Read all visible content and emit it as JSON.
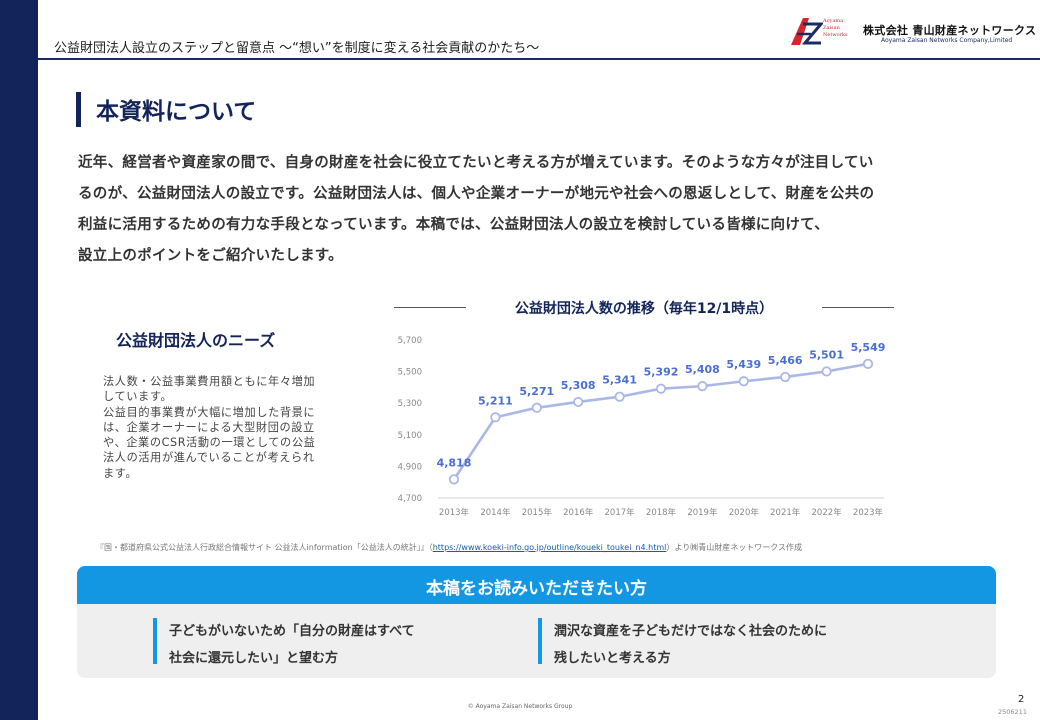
{
  "header": {
    "title": "公益財団法人設立のステップと留意点 〜“想い”を制度に変える社会貢献のかたち〜",
    "logo_mark_text": [
      "Aoyama",
      "Zaisan",
      "Networks"
    ],
    "company_name": "株式会社 青山財産ネットワークス",
    "company_name_en": "Aoyama Zaisan Networks Company,Limited"
  },
  "section": {
    "title": "本資料について"
  },
  "intro": {
    "lines": [
      "近年、経営者や資産家の間で、自身の財産を社会に役立てたいと考える方が増えています。そのような方々が注目してい",
      "るのが、公益財団法人の設立です。公益財団法人は、個人や企業オーナーが地元や社会への恩返しとして、財産を公共の",
      "利益に活用するための有力な手段となっています。本稿では、公益財団法人の設立を検討している皆様に向けて、",
      "設立上のポイントをご紹介いたします。"
    ]
  },
  "needs": {
    "title": "公益財団法人のニーズ",
    "lines": [
      "法人数・公益事業費用額ともに年々増加",
      "しています。",
      "公益目的事業費が大幅に増加した背景に",
      "は、企業オーナーによる大型財団の設立",
      "や、企業のCSR活動の一環としての公益",
      "法人の活用が進んでいることが考えられ",
      "ます。"
    ]
  },
  "chart_data": {
    "type": "line",
    "title": "公益財団法人数の推移（毎年12/1時点）",
    "categories": [
      "2013年",
      "2014年",
      "2015年",
      "2016年",
      "2017年",
      "2018年",
      "2019年",
      "2020年",
      "2021年",
      "2022年",
      "2023年"
    ],
    "values": [
      4818,
      5211,
      5271,
      5308,
      5341,
      5392,
      5408,
      5439,
      5466,
      5501,
      5549
    ],
    "data_labels": [
      "4,818",
      "5,211",
      "5,271",
      "5,308",
      "5,341",
      "5,392",
      "5,408",
      "5,439",
      "5,466",
      "5,501",
      "5,549"
    ],
    "y_ticks": [
      "5,700",
      "5,500",
      "5,300",
      "5,100",
      "4,900",
      "4,700"
    ],
    "ylim": [
      4700,
      5700
    ],
    "grid": false,
    "line_color": "#a9b8e6",
    "label_color": "#4a6fd0"
  },
  "source": {
    "prefix": "『国・都道府県公式公益法人行政総合情報サイト 公益法人information「公益法人の統計」』（",
    "link": "https://www.koeki-info.go.jp/outline/koueki_toukei_n4.html",
    "suffix": "）より㈱青山財産ネットワークス作成"
  },
  "readers": {
    "title": "本稿をお読みいただきたい方",
    "items": [
      {
        "lines": [
          "子どもがいないため「自分の財産はすべて",
          "社会に還元したい」と望む方"
        ]
      },
      {
        "lines": [
          "潤沢な資産を子どもだけではなく社会のために",
          "残したいと考える方"
        ]
      }
    ]
  },
  "footer": {
    "copyright": "© Aoyama Zaisan Networks Group",
    "page_number": "2",
    "doc_code": "2506211"
  },
  "colors": {
    "navy": "#13245a",
    "accent_blue": "#1497e2",
    "logo_red": "#d3262f"
  }
}
